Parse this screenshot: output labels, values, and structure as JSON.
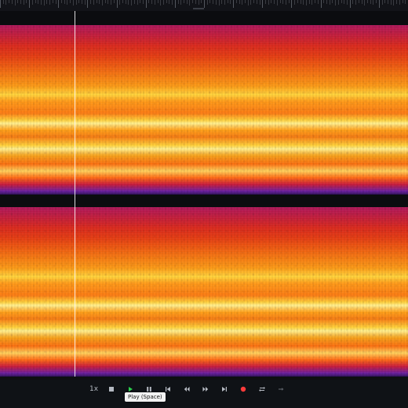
{
  "toolbar": {
    "speed_label": "1x",
    "tooltip_play": "Play (Space)"
  },
  "colors": {
    "accent_play": "#2bd14d",
    "record": "#ff3b3b",
    "toolbar_icon": "#b5bac2"
  },
  "icons": [
    "stop-icon",
    "play-icon",
    "pause-icon",
    "skip-to-start-icon",
    "rewind-icon",
    "fast-forward-icon",
    "skip-to-end-icon",
    "record-icon",
    "loop-icon",
    "skip-selection-icon"
  ]
}
